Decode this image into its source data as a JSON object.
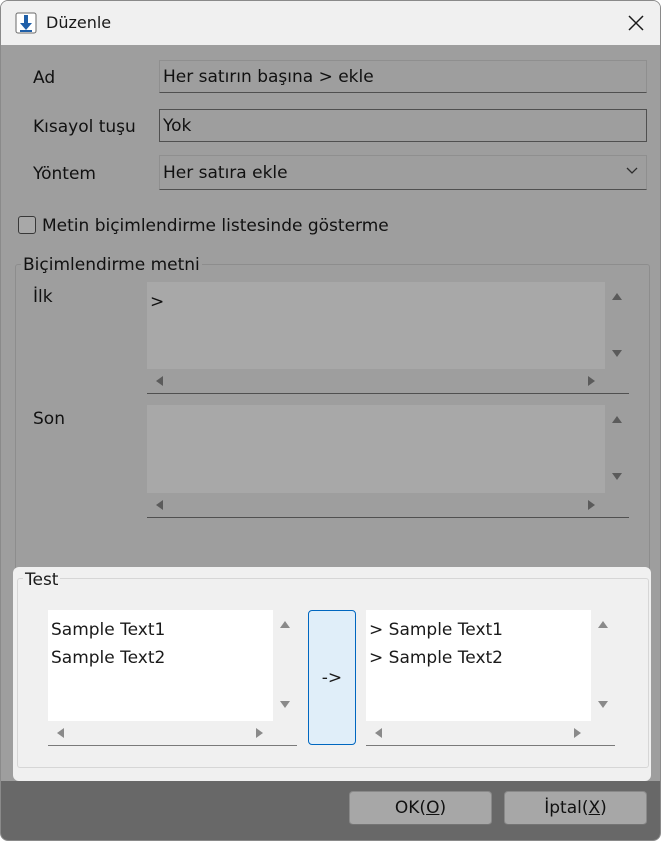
{
  "window": {
    "title": "Düzenle"
  },
  "form": {
    "name_label": "Ad",
    "name_value": "Her satırın başına > ekle",
    "shortcut_label": "Kısayol tuşu",
    "shortcut_value": "Yok",
    "method_label": "Yöntem",
    "method_value": "Her satıra ekle",
    "hide_checkbox_label": "Metin biçimlendirme listesinde gösterme",
    "hide_checkbox_checked": false
  },
  "format_group": {
    "title": "Biçimlendirme metni",
    "first_label": "İlk",
    "first_value": ">",
    "last_label": "Son",
    "last_value": ""
  },
  "test_group": {
    "title": "Test",
    "input_text": "Sample Text1\nSample Text2",
    "arrow_label": "->",
    "output_text": "> Sample Text1\n> Sample Text2"
  },
  "buttons": {
    "ok_prefix": "OK(",
    "ok_key": "O",
    "ok_suffix": ")",
    "cancel_prefix": "İptal(",
    "cancel_key": "X",
    "cancel_suffix": ")"
  },
  "colors": {
    "accent": "#0067c0",
    "arrow_button_bg": "#e0eef9",
    "app_icon": "#1f5fa8"
  }
}
